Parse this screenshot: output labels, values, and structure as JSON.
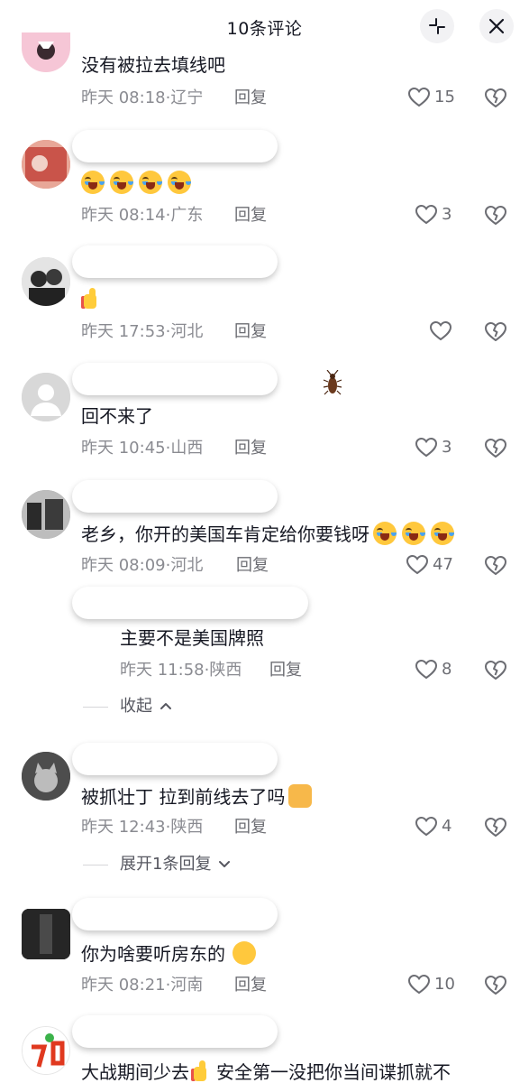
{
  "header": {
    "title": "10条评论"
  },
  "comments": [
    {
      "text": "没有被拉去填线吧",
      "time": "昨天 08:18",
      "region": "辽宁",
      "likes": "15"
    },
    {
      "text": "",
      "time": "昨天 08:14",
      "region": "广东",
      "likes": "3"
    },
    {
      "text": "",
      "time": "昨天 17:53",
      "region": "河北",
      "likes": ""
    },
    {
      "text": "回不来了",
      "time": "昨天 10:45",
      "region": "山西",
      "likes": "3"
    },
    {
      "text": "老乡，你开的美国车肯定给你要钱呀",
      "time": "昨天 08:09",
      "region": "河北",
      "likes": "47"
    },
    {
      "text": "被抓壮丁 拉到前线去了吗",
      "time": "昨天 12:43",
      "region": "陕西",
      "likes": "4"
    },
    {
      "text": "你为啥要听房东的",
      "time": "昨天 08:21",
      "region": "河南",
      "likes": "10"
    },
    {
      "text": "大战期间少去",
      "text2": "安全第一没把你当间谍抓就不"
    }
  ],
  "reply": {
    "text": "主要不是美国牌照",
    "time": "昨天 11:58",
    "region": "陕西",
    "likes": "8"
  },
  "labels": {
    "reply": "回复",
    "separator": "·",
    "collapse": "收起",
    "expand": "展开1条回复"
  },
  "icons": [
    "collapse-icon",
    "close-icon",
    "heart-icon",
    "broken-heart-icon",
    "chevron-up-icon",
    "chevron-down-icon"
  ]
}
